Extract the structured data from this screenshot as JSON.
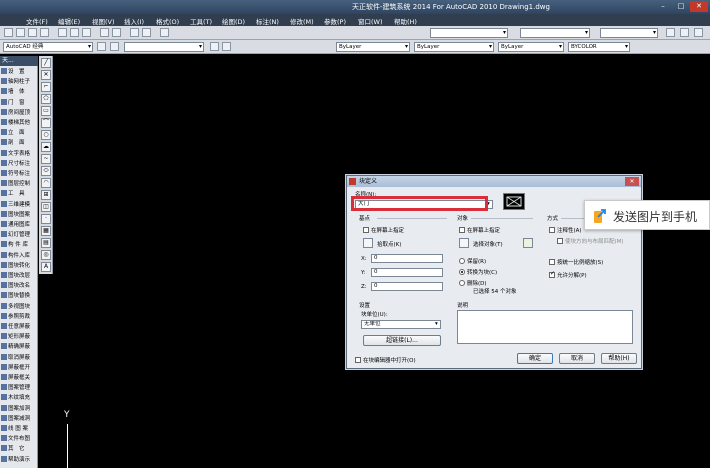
{
  "window": {
    "title": "天正软件-建筑系统 2014  For AutoCAD 2010        Drawing1.dwg"
  },
  "menu": [
    "文件(F)",
    "编辑(E)",
    "视图(V)",
    "插入(I)",
    "格式(O)",
    "工具(T)",
    "绘图(D)",
    "标注(N)",
    "修改(M)",
    "参数(P)",
    "窗口(W)",
    "帮助(H)"
  ],
  "toolbar2": {
    "workspace": "AutoCAD 经典",
    "layer_color": "ByLayer",
    "linetype": "ByLayer",
    "lineweight": "ByLayer",
    "plotstyle": "BYCOLOR"
  },
  "tz_panel": {
    "header": "天...",
    "items": [
      "设　置",
      "轴网柱子",
      "墙　体",
      "门　窗",
      "房间屋顶",
      "楼梯其他",
      "立　面",
      "剖　面",
      "文字表格",
      "尺寸标注",
      "符号标注",
      "图层控制",
      "工　具",
      "三维建模",
      "图块图案",
      "通用图库",
      "幻灯管理",
      "构 件 库",
      "构件入库",
      "图块转化",
      "图块改层",
      "图块改名",
      "图块替换",
      "多视图块",
      "参照剪裁",
      "任意屏蔽",
      "矩形屏蔽",
      "精确屏蔽",
      "取消屏蔽",
      "屏蔽框开",
      "屏蔽框关",
      "图案管理",
      "木纹填充",
      "图案加洞",
      "图案减洞",
      "线 图 案",
      "文件布图",
      "其　它",
      "帮助演示"
    ]
  },
  "dialog": {
    "title": "块定义",
    "name_label": "名称(N):",
    "name_value": "大门",
    "base_point": {
      "title": "基点",
      "specify_on_screen": "在屏幕上指定",
      "pick_point": "拾取点(K)",
      "x_label": "X:",
      "x_value": "0",
      "y_label": "Y:",
      "y_value": "0",
      "z_label": "Z:",
      "z_value": "0"
    },
    "objects": {
      "title": "对象",
      "specify_on_screen": "在屏幕上指定",
      "select_objects": "选择对象(T)",
      "retain": "保留(R)",
      "convert": "转换为块(C)",
      "delete": "删除(D)",
      "selected_count": "已选择 54 个对象"
    },
    "behavior": {
      "title": "方式",
      "annotative": "注释性(A)",
      "match_orientation": "使块方向与布局匹配(M)",
      "scale_uniformly": "按统一比例缩放(S)",
      "allow_exploding": "允许分解(P)"
    },
    "settings": {
      "title": "设置",
      "block_unit_label": "块单位(U):",
      "block_unit_value": "无单位",
      "hyperlink": "超链接(L)..."
    },
    "description_label": "说明",
    "open_in_editor": "在块编辑器中打开(O)",
    "ok": "确定",
    "cancel": "取消",
    "help": "帮助(H)"
  },
  "overlay": {
    "send_to_phone": "发送图片到手机"
  },
  "ucs": {
    "y_label": "Y"
  }
}
